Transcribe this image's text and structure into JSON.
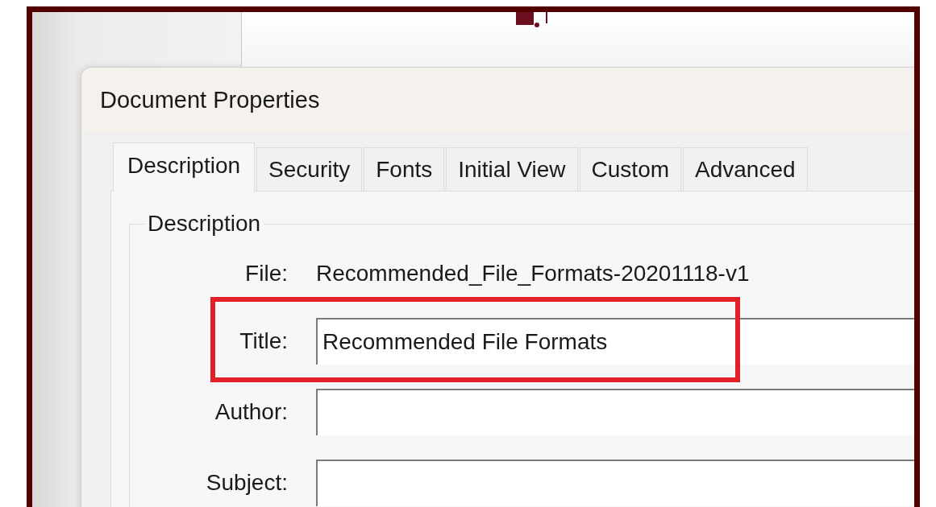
{
  "window": {
    "title": "Document Properties"
  },
  "tabs": [
    {
      "label": "Description",
      "selected": true
    },
    {
      "label": "Security",
      "selected": false
    },
    {
      "label": "Fonts",
      "selected": false
    },
    {
      "label": "Initial View",
      "selected": false
    },
    {
      "label": "Custom",
      "selected": false
    },
    {
      "label": "Advanced",
      "selected": false
    }
  ],
  "group": {
    "title": "Description"
  },
  "fields": [
    {
      "kind": "text",
      "label": "File:",
      "value": "Recommended_File_Formats-20201118-v1"
    },
    {
      "kind": "input",
      "label": "Title:",
      "value": "Recommended File Formats",
      "highlighted": true
    },
    {
      "kind": "input",
      "label": "Author:",
      "highlighted": false
    },
    {
      "kind": "input",
      "label": "Subject:",
      "highlighted": false
    }
  ]
}
